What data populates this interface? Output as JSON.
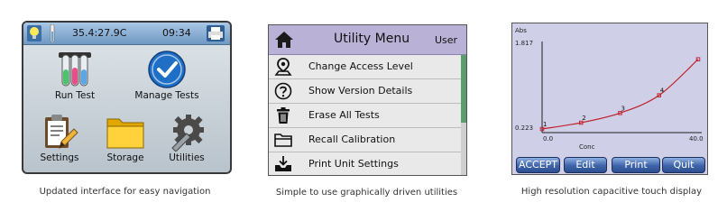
{
  "screen1": {
    "temperature": "35.4:27.9C",
    "time": "09:34",
    "tiles": {
      "run_test": "Run Test",
      "manage_tests": "Manage Tests",
      "settings": "Settings",
      "storage": "Storage",
      "utilities": "Utilities"
    },
    "caption": "Updated interface for easy navigation"
  },
  "screen2": {
    "title": "Utility Menu",
    "user": "User",
    "items": [
      {
        "label": "Change Access Level",
        "icon": "person-pin-icon"
      },
      {
        "label": "Show Version Details",
        "icon": "question-circle-icon"
      },
      {
        "label": "Erase All Tests",
        "icon": "trash-icon"
      },
      {
        "label": "Recall Calibration",
        "icon": "folder-icon"
      },
      {
        "label": "Print Unit Settings",
        "icon": "printer-tray-icon"
      }
    ],
    "caption": "Simple to use graphically driven utilities"
  },
  "screen3": {
    "buttons": {
      "accept": "ACCEPT",
      "edit": "Edit",
      "print": "Print",
      "quit": "Quit"
    },
    "caption": "High resolution capacitive touch display"
  },
  "chart_data": {
    "type": "line",
    "ylabel": "Abs",
    "xlabel": "Conc",
    "xlim": [
      0.0,
      40.0
    ],
    "ylim": [
      0.223,
      1.817
    ],
    "x_tick_labels": [
      "0.0",
      "40.0"
    ],
    "y_tick_labels": [
      "1.817",
      "0.223"
    ],
    "x": [
      0,
      10,
      20,
      30,
      40
    ],
    "values": [
      0.223,
      0.34,
      0.52,
      0.85,
      1.52
    ],
    "point_labels": [
      "1",
      "2",
      "3",
      "4"
    ],
    "line_color": "#c0202a",
    "grid": false
  }
}
